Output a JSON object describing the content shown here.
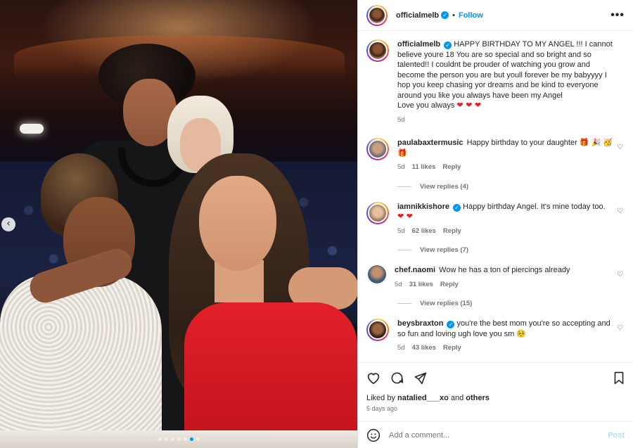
{
  "header": {
    "username": "officialmelb",
    "separator": "•",
    "follow_label": "Follow",
    "more_icon": "•••"
  },
  "caption": {
    "username": "officialmelb",
    "text": "HAPPY BIRTHDAY TO MY ANGEL !!! I cannot believe youre 18 You are so special and so bright and so talented!! I couldnt be prouder of watching you grow and become the person you are but youll forever be my babyyyy I hop you keep chasing yor dreams and be kind to everyone around you like you always have been my Angel",
    "line2": "Love you always",
    "hearts": "❤ ❤ ❤",
    "age": "5d"
  },
  "comments": [
    {
      "username": "paulabaxtermusic",
      "verified": false,
      "text": "Happy birthday to your daughter 🎁 🎉 🥳 🎁",
      "age": "5d",
      "likes": "11 likes",
      "reply": "Reply",
      "view_replies": "View replies (4)"
    },
    {
      "username": "iamnikkishore",
      "verified": true,
      "text": "Happy birthday Angel. It's mine today too.",
      "hearts": "❤ ❤",
      "age": "5d",
      "likes": "62 likes",
      "reply": "Reply",
      "view_replies": "View replies (7)"
    },
    {
      "username": "chef.naomi",
      "verified": false,
      "text": "Wow he has a ton of piercings already",
      "age": "5d",
      "likes": "31 likes",
      "reply": "Reply",
      "view_replies": "View replies (15)"
    },
    {
      "username": "beysbraxton",
      "verified": true,
      "text": "you're the best mom you're so accepting and so fun and loving ugh love you sm 🥺",
      "age": "5d",
      "likes": "43 likes",
      "reply": "Reply"
    }
  ],
  "actions": {
    "liked_by_prefix": "Liked by",
    "liked_by_user": "natalied___xo",
    "liked_by_and": "and",
    "liked_by_others": "others",
    "time_ago": "5 days ago"
  },
  "comment_box": {
    "placeholder": "Add a comment...",
    "post_label": "Post"
  },
  "carousel": {
    "prev_icon": "‹",
    "dot_count": 7,
    "active_dot": 5
  },
  "colors": {
    "link_blue": "#0095f6",
    "heart_red": "#ed1c24",
    "post_disabled": "#b2dffc"
  }
}
